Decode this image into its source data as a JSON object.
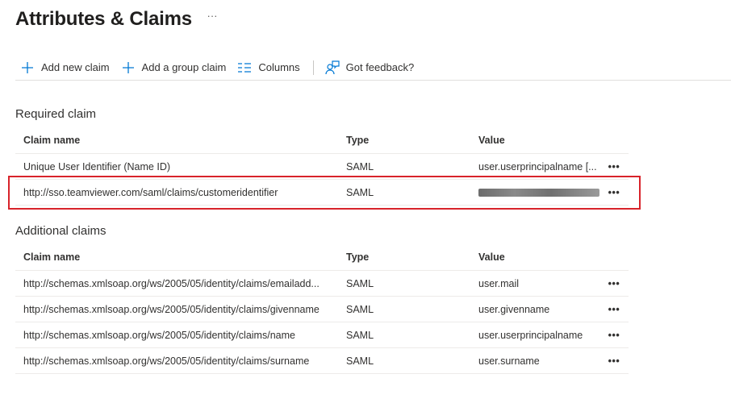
{
  "header": {
    "title": "Attributes & Claims",
    "more_label": "···"
  },
  "toolbar": {
    "add_claim": "Add new claim",
    "add_group_claim": "Add a group claim",
    "columns": "Columns",
    "feedback": "Got feedback?"
  },
  "required": {
    "title": "Required claim",
    "columns": {
      "name": "Claim name",
      "type": "Type",
      "value": "Value"
    },
    "rows": [
      {
        "name": "Unique User Identifier (Name ID)",
        "type": "SAML",
        "value": "user.userprincipalname [..."
      },
      {
        "name": "http://sso.teamviewer.com/saml/claims/customeridentifier",
        "type": "SAML",
        "value": ""
      }
    ]
  },
  "additional": {
    "title": "Additional claims",
    "columns": {
      "name": "Claim name",
      "type": "Type",
      "value": "Value"
    },
    "rows": [
      {
        "name": "http://schemas.xmlsoap.org/ws/2005/05/identity/claims/emailadd...",
        "type": "SAML",
        "value": "user.mail"
      },
      {
        "name": "http://schemas.xmlsoap.org/ws/2005/05/identity/claims/givenname",
        "type": "SAML",
        "value": "user.givenname"
      },
      {
        "name": "http://schemas.xmlsoap.org/ws/2005/05/identity/claims/name",
        "type": "SAML",
        "value": "user.userprincipalname"
      },
      {
        "name": "http://schemas.xmlsoap.org/ws/2005/05/identity/claims/surname",
        "type": "SAML",
        "value": "user.surname"
      }
    ]
  },
  "row_more_label": "•••",
  "colors": {
    "accent": "#0078d4",
    "highlight_border": "#d8232a"
  }
}
